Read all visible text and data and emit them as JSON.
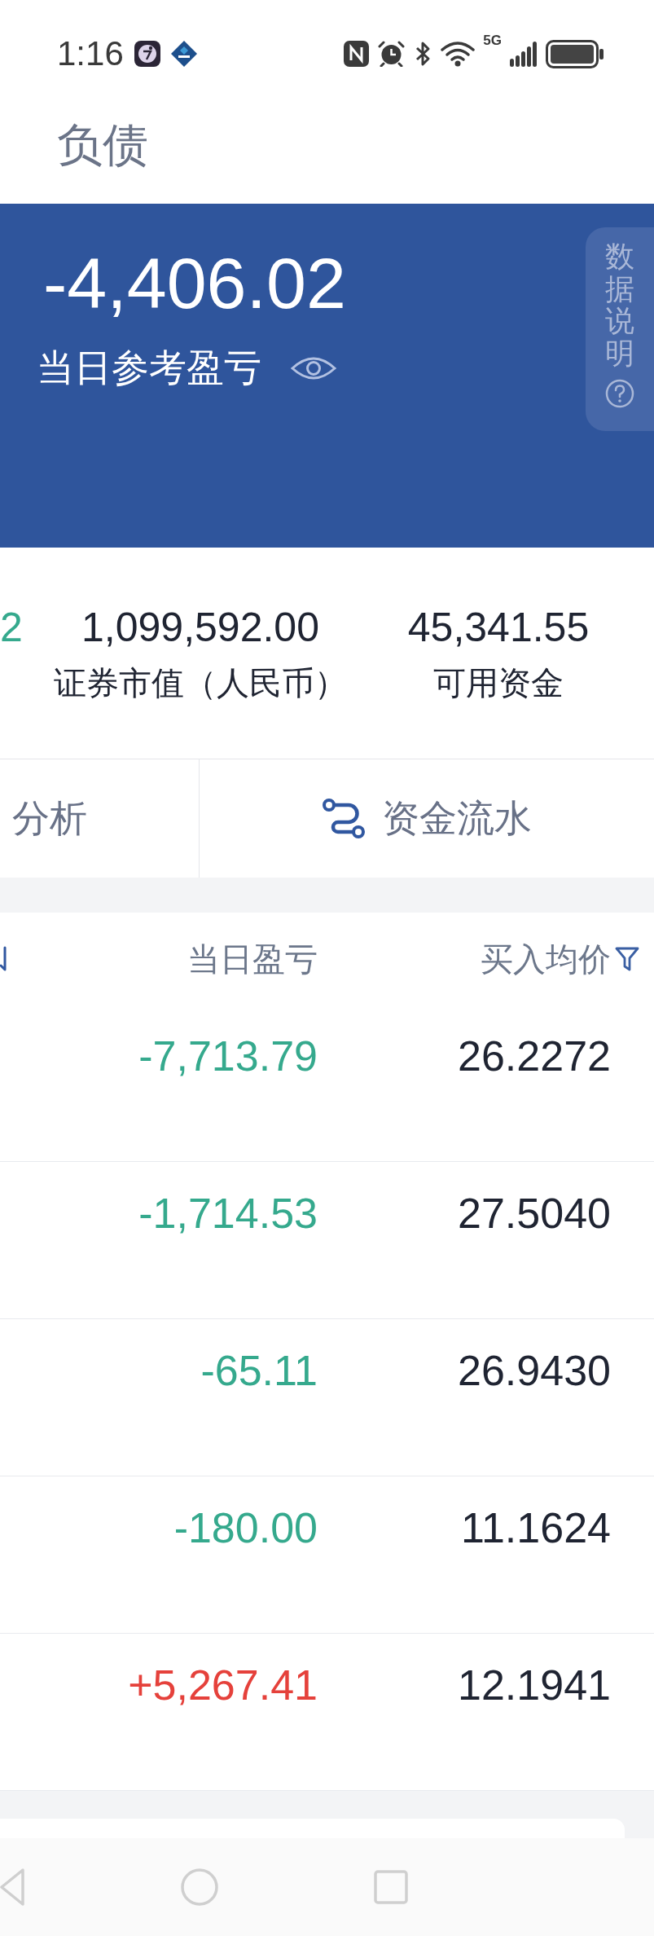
{
  "status_bar": {
    "time": "1:16",
    "network": "5G"
  },
  "header": {
    "title": "负债"
  },
  "summary": {
    "amount": "-4,406.02",
    "label": "当日参考盈亏",
    "info_tab": "数据说明"
  },
  "stats": [
    {
      "value": "2",
      "color": "#35a98d"
    },
    {
      "value": "1,099,592.00",
      "label": "证券市值（人民币）",
      "color": "#1f2432"
    },
    {
      "value": "45,341.55",
      "label": "可用资金",
      "color": "#1f2432"
    }
  ],
  "shortcuts": [
    {
      "label": "分析",
      "kind": "text"
    },
    {
      "label": "资金流水",
      "kind": "flow"
    }
  ],
  "table": {
    "columns": [
      {
        "label": "当日盈亏"
      },
      {
        "label": "买入均价"
      }
    ],
    "rows": [
      {
        "daily_pnl": "-7,713.79",
        "color": "#35a98d",
        "avg_buy_price": "26.2272"
      },
      {
        "daily_pnl": "-1,714.53",
        "color": "#35a98d",
        "avg_buy_price": "27.5040"
      },
      {
        "daily_pnl": "-65.11",
        "color": "#35a98d",
        "avg_buy_price": "26.9430"
      },
      {
        "daily_pnl": "-180.00",
        "color": "#35a98d",
        "avg_buy_price": "11.1624"
      },
      {
        "daily_pnl": "+5,267.41",
        "color": "#e5413b",
        "avg_buy_price": "12.1941"
      }
    ]
  }
}
